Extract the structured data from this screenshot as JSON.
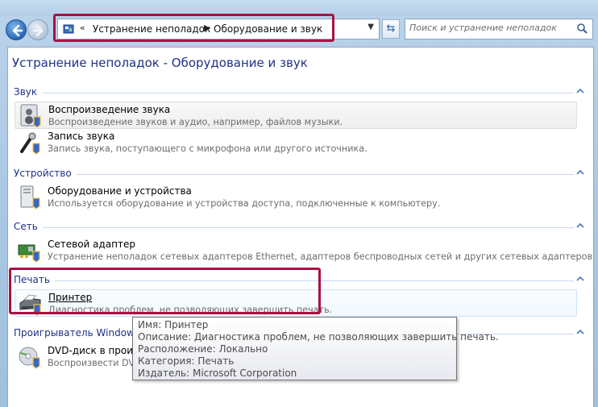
{
  "address_bar": {
    "overflow_marker": "«",
    "crumbs": [
      "Устранение неполадок",
      "Оборудование и звук"
    ]
  },
  "search": {
    "placeholder": "Поиск и устранение неполадок"
  },
  "page": {
    "title": "Устранение неполадок - Оборудование и звук"
  },
  "groups": [
    {
      "name": "Звук",
      "items": [
        {
          "title": "Воспроизведение звука",
          "desc": "Воспроизведение звуков и аудио, например, файлов музыки.",
          "icon": "speaker-icon"
        },
        {
          "title": "Запись звука",
          "desc": "Запись звука, поступающего с микрофона или другого источника.",
          "icon": "microphone-icon"
        }
      ]
    },
    {
      "name": "Устройство",
      "items": [
        {
          "title": "Оборудование и устройства",
          "desc": "Используется оборудование и устройства доступа, подключенные к компьютеру.",
          "icon": "hardware-icon"
        }
      ]
    },
    {
      "name": "Сеть",
      "items": [
        {
          "title": "Сетевой адаптер",
          "desc": "Устранение неполадок сетевых адаптеров Ethernet, адаптеров беспроводных сетей и других сетевых адаптеров.",
          "icon": "network-adapter-icon"
        }
      ]
    },
    {
      "name": "Печать",
      "items": [
        {
          "title": "Принтер",
          "desc": "Диагностика проблем, не позволяющих завершить печать.",
          "icon": "printer-icon"
        }
      ]
    },
    {
      "name": "Проигрыватель Windows M",
      "items": [
        {
          "title": "DVD-диск в проигр",
          "desc": "Воспроизвести DVD",
          "icon": "dvd-icon"
        }
      ]
    }
  ],
  "tooltip": {
    "lines": [
      "Имя: Принтер",
      "Описание: Диагностика проблем, не позволяющих завершить печать.",
      "Расположение: Локально",
      "Категория: Печать",
      "Издатель: Microsoft Corporation"
    ]
  },
  "colors": {
    "highlight": "#a8123f",
    "heading": "#1e3287",
    "description": "#6d6d6d"
  }
}
